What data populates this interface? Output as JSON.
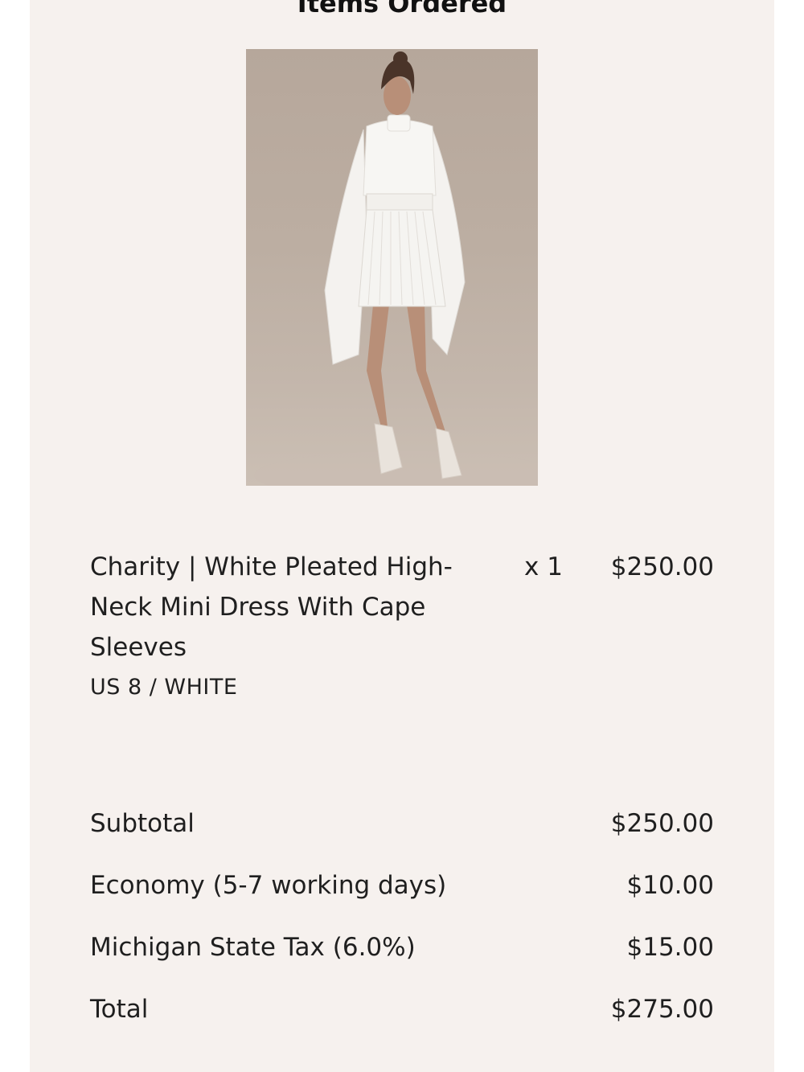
{
  "section": {
    "title": "Items Ordered"
  },
  "item": {
    "image_alt": "White pleated high-neck mini dress with cape sleeves",
    "name": "Charity | White Pleated High-Neck Mini Dress With Cape Sleeves",
    "variant": "US 8 / WHITE",
    "quantity": "x 1",
    "price": "$250.00"
  },
  "summary": {
    "subtotal_label": "Subtotal",
    "subtotal_value": "$250.00",
    "shipping_label": "Economy (5-7 working days)",
    "shipping_value": "$10.00",
    "tax_label": "Michigan State Tax (6.0%)",
    "tax_value": "$15.00",
    "total_label": "Total",
    "total_value": "$275.00"
  },
  "colors": {
    "panel_background": "#f6f1ee",
    "text": "#1f1f1f"
  }
}
